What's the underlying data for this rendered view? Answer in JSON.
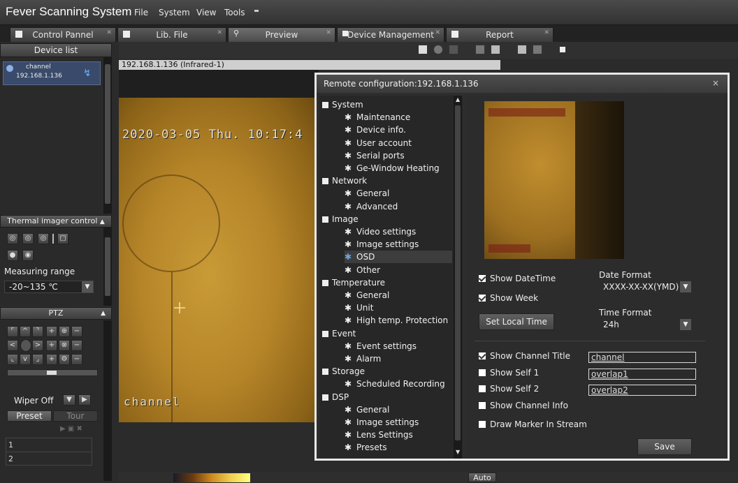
{
  "app": {
    "title": "Fever Scanning System",
    "menu": [
      "File",
      "System",
      "View",
      "Tools"
    ]
  },
  "tabs": [
    {
      "label": "Control Pannel"
    },
    {
      "label": "Lib. File"
    },
    {
      "label": "Preview"
    },
    {
      "label": "Device Management"
    },
    {
      "label": "Report"
    }
  ],
  "device_list": {
    "header": "Device list",
    "channel_name": "channel",
    "channel_ip": "192.168.1.136"
  },
  "thermal": {
    "header": "Thermal imager control",
    "measuring_label": "Measuring range",
    "measuring_value": "-20~135 ℃"
  },
  "ptz": {
    "header": "PTZ",
    "wiper": "Wiper Off",
    "preset_tab": "Preset",
    "tour_tab": "Tour",
    "rows": [
      "1",
      "2"
    ]
  },
  "video": {
    "header": "192.168.1.136 (Infrared-1)",
    "osd_time": "2020-03-05 Thu. 10:17:4",
    "osd_channel": "channel",
    "auto_label": "Auto"
  },
  "dialog": {
    "title": "Remote configuration:192.168.1.136",
    "close": "×",
    "tree": [
      {
        "label": "System",
        "level": 0
      },
      {
        "label": "Maintenance",
        "level": 1
      },
      {
        "label": "Device info.",
        "level": 1
      },
      {
        "label": "User account",
        "level": 1
      },
      {
        "label": "Serial ports",
        "level": 1
      },
      {
        "label": "Ge-Window Heating",
        "level": 1
      },
      {
        "label": "Network",
        "level": 0
      },
      {
        "label": "General",
        "level": 1
      },
      {
        "label": "Advanced",
        "level": 1
      },
      {
        "label": "Image",
        "level": 0
      },
      {
        "label": "Video settings",
        "level": 1
      },
      {
        "label": "Image settings",
        "level": 1
      },
      {
        "label": "OSD",
        "level": 1,
        "selected": true
      },
      {
        "label": "Other",
        "level": 1
      },
      {
        "label": "Temperature",
        "level": 0
      },
      {
        "label": "General",
        "level": 1
      },
      {
        "label": "Unit",
        "level": 1
      },
      {
        "label": "High temp. Protection",
        "level": 1
      },
      {
        "label": "Event",
        "level": 0
      },
      {
        "label": "Event settings",
        "level": 1
      },
      {
        "label": "Alarm",
        "level": 1
      },
      {
        "label": "Storage",
        "level": 0
      },
      {
        "label": "Scheduled Recording",
        "level": 1
      },
      {
        "label": "DSP",
        "level": 0
      },
      {
        "label": "General",
        "level": 1
      },
      {
        "label": "Image settings",
        "level": 1
      },
      {
        "label": "Lens Settings",
        "level": 1
      },
      {
        "label": "Presets",
        "level": 1
      }
    ],
    "osd": {
      "show_datetime": {
        "label": "Show DateTime",
        "checked": true
      },
      "show_week": {
        "label": "Show Week",
        "checked": true
      },
      "date_format_label": "Date Format",
      "date_format_value": "XXXX-XX-XX(YMD)",
      "time_format_label": "Time Format",
      "time_format_value": "24h",
      "set_local_time": "Set Local Time",
      "show_channel_title": {
        "label": "Show Channel Title",
        "checked": true,
        "value": "channel"
      },
      "show_self_1": {
        "label": "Show Self 1",
        "checked": false,
        "value": "overlap1"
      },
      "show_self_2": {
        "label": "Show Self 2",
        "checked": false,
        "value": "overlap2"
      },
      "show_channel_info": {
        "label": "Show Channel Info",
        "checked": false
      },
      "draw_marker": {
        "label": "Draw Marker In Stream",
        "checked": false
      },
      "save": "Save"
    }
  }
}
